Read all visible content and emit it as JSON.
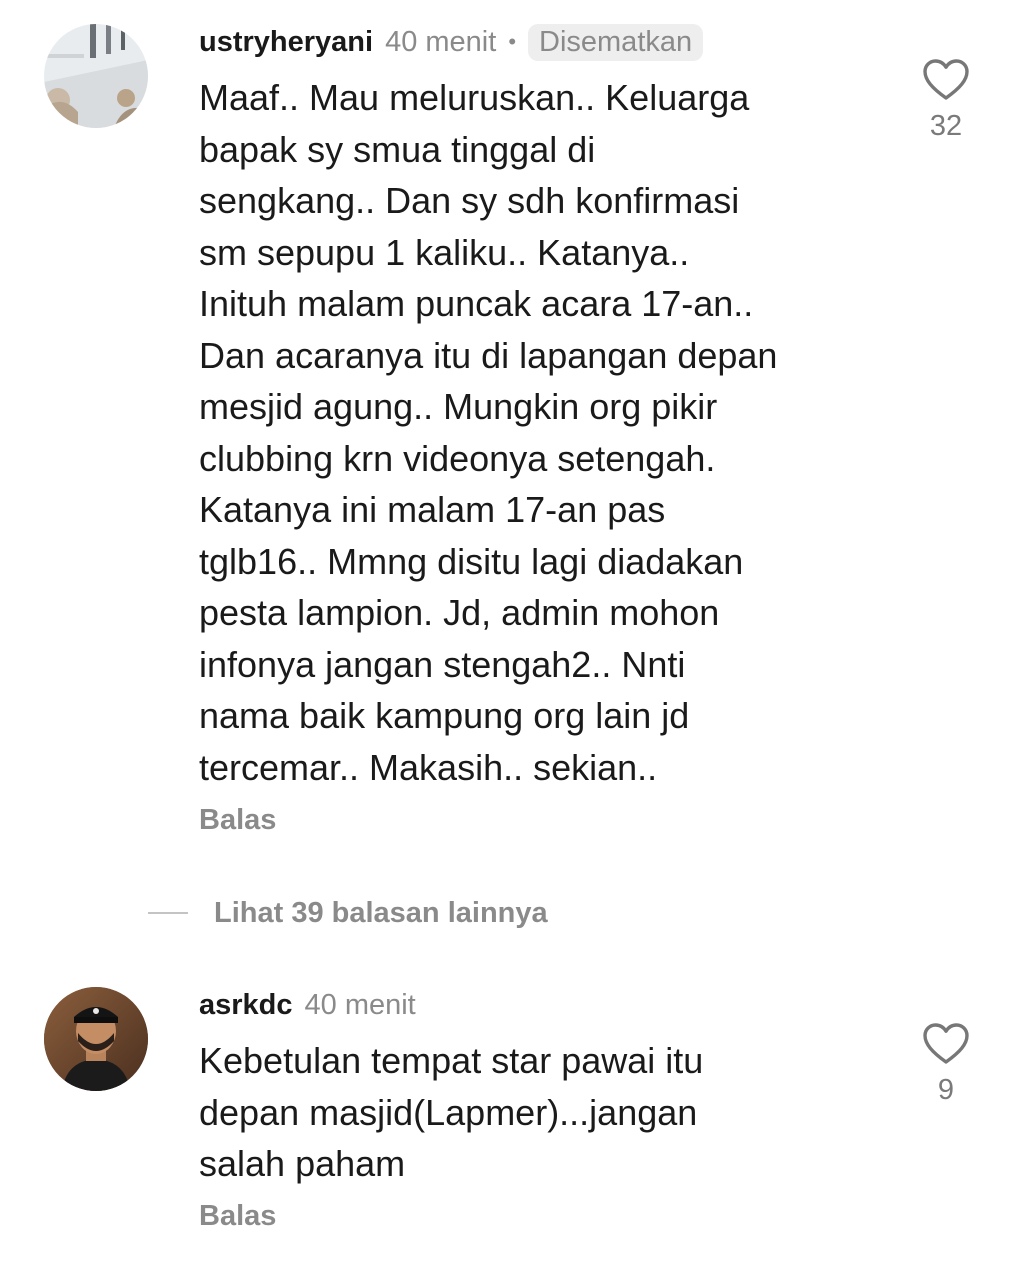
{
  "comments": [
    {
      "username": "ustryheryani",
      "time": "40 menit",
      "separator": "•",
      "badge": "Disematkan",
      "lines": [
        "Maaf.. Mau meluruskan.. Keluarga",
        "bapak sy smua tinggal di",
        "sengkang.. Dan sy sdh konfirmasi",
        "sm sepupu 1 kaliku.. Katanya..",
        "Inituh malam puncak acara 17-an..",
        "Dan acaranya itu di lapangan depan",
        "mesjid agung.. Mungkin org pikir",
        "clubbing krn videonya setengah.",
        "Katanya ini malam 17-an pas",
        "tglb16.. Mmng disitu lagi diadakan",
        "pesta lampion. Jd, admin mohon",
        "infonya jangan stengah2.. Nnti",
        "nama baik kampung org lain jd",
        "tercemar.. Makasih.. sekian.."
      ],
      "reply_label": "Balas",
      "like_icon": "heart-outline-icon",
      "likes": "32"
    },
    {
      "username": "asrkdc",
      "time": "40 menit",
      "lines": [
        "Kebetulan tempat star pawai itu",
        "depan masjid(Lapmer)...jangan",
        "salah paham"
      ],
      "reply_label": "Balas",
      "like_icon": "heart-outline-icon",
      "likes": "9"
    }
  ],
  "view_replies": "Lihat 39 balasan lainnya",
  "colors": {
    "text": "#1a1a1a",
    "muted": "#8a8a8a",
    "badge_bg": "#eeeeee",
    "background": "#ffffff"
  }
}
